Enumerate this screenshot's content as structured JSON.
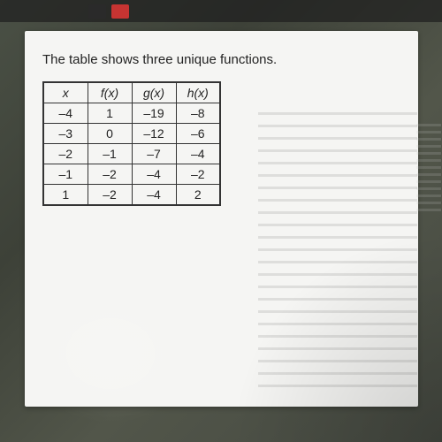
{
  "title": "The table shows three unique functions.",
  "chart_data": {
    "type": "table",
    "columns": [
      "x",
      "f(x)",
      "g(x)",
      "h(x)"
    ],
    "rows": [
      {
        "x": "–4",
        "f": "1",
        "g": "–19",
        "h": "–8"
      },
      {
        "x": "–3",
        "f": "0",
        "g": "–12",
        "h": "–6"
      },
      {
        "x": "–2",
        "f": "–1",
        "g": "–7",
        "h": "–4"
      },
      {
        "x": "–1",
        "f": "–2",
        "g": "–4",
        "h": "–2"
      },
      {
        "x": "1",
        "f": "–2",
        "g": "–4",
        "h": "2"
      }
    ]
  }
}
